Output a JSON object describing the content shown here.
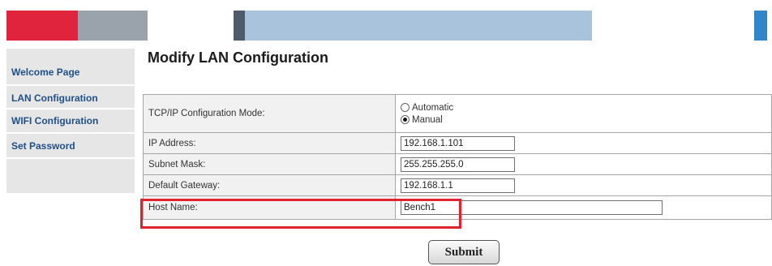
{
  "banner": {
    "colors": {
      "red": "#e0243d",
      "gray": "#9aa3ab",
      "dark": "#4e5b69",
      "blue": "#a9c3dc",
      "right_blue": "#2f86c9"
    }
  },
  "sidebar": {
    "items": [
      {
        "label": "Welcome Page"
      },
      {
        "label": "LAN Configuration"
      },
      {
        "label": "WIFI Configuration"
      },
      {
        "label": "Set Password"
      }
    ]
  },
  "main": {
    "title": "Modify LAN Configuration",
    "mode": {
      "label": "TCP/IP Configuration Mode:",
      "options": [
        {
          "label": "Automatic",
          "checked": false
        },
        {
          "label": "Manual",
          "checked": true
        }
      ]
    },
    "ip": {
      "label": "IP Address:",
      "value": "192.168.1.101"
    },
    "subnet": {
      "label": "Subnet Mask:",
      "value": "255.255.255.0"
    },
    "gateway": {
      "label": "Default Gateway:",
      "value": "192.168.1.1"
    },
    "host": {
      "label": "Host Name:",
      "value": "Bench1"
    },
    "submit_label": "Submit",
    "highlight_color": "#e0242f"
  }
}
